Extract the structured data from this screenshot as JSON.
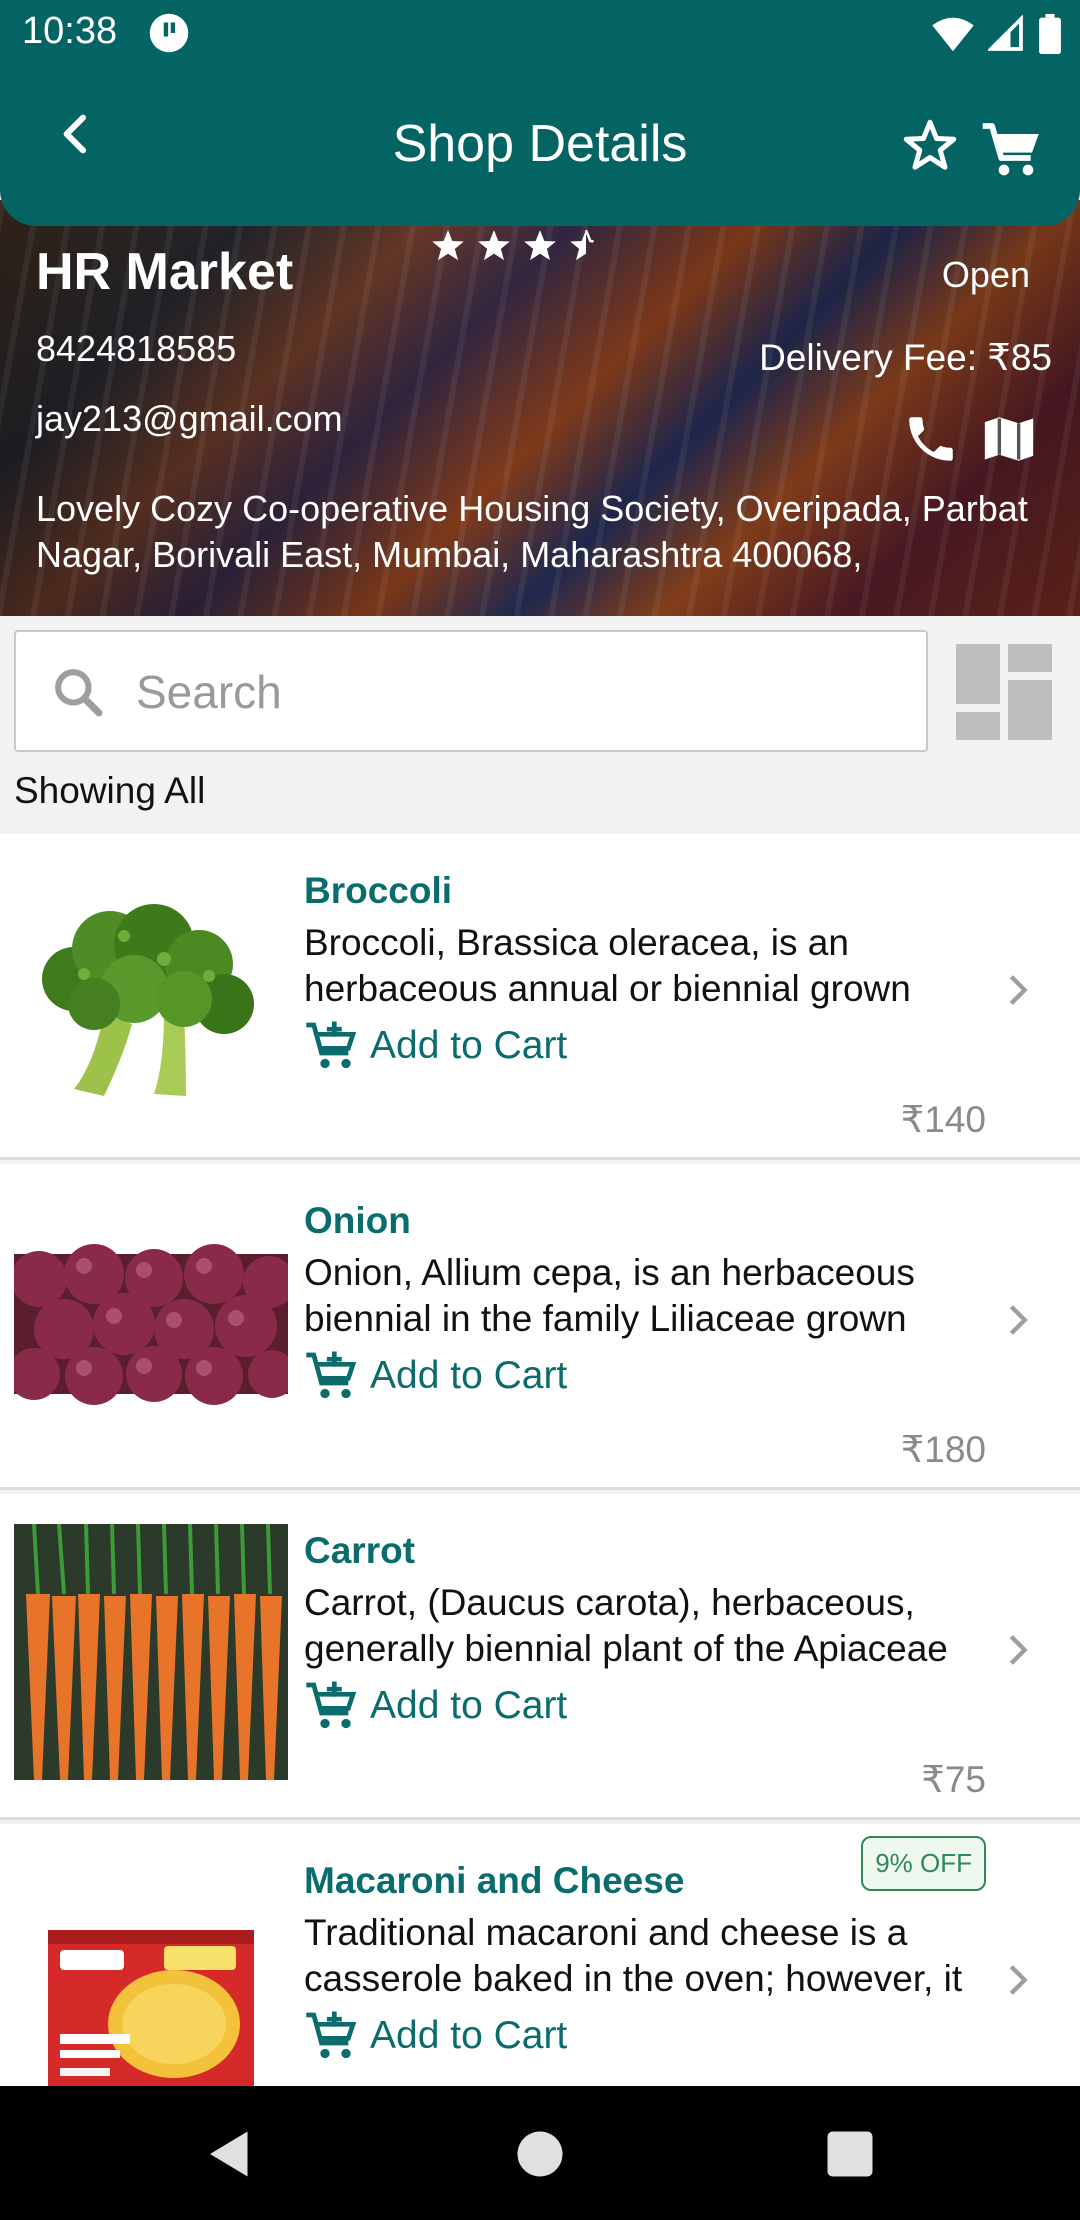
{
  "status_bar": {
    "time": "10:38"
  },
  "app_bar": {
    "title": "Shop Details"
  },
  "shop": {
    "name": "HR Market",
    "rating": 3.5,
    "status": "Open",
    "phone": "8424818585",
    "delivery_fee": "Delivery Fee: ₹85",
    "email": "jay213@gmail.com",
    "address": "Lovely Cozy Co-operative Housing Society, Overipada, Parbat Nagar, Borivali East, Mumbai, Maharashtra 400068,"
  },
  "search": {
    "placeholder": "Search",
    "value": ""
  },
  "filter": {
    "label": "Showing All"
  },
  "products": [
    {
      "name": "Broccoli",
      "desc": "Broccoli, Brassica oleracea, is an herbaceous annual or biennial grown",
      "add_label": "Add to Cart",
      "price": "₹140",
      "discount": ""
    },
    {
      "name": "Onion",
      "desc": "Onion, Allium cepa, is an herbaceous biennial in the family Liliaceae grown",
      "add_label": "Add to Cart",
      "price": "₹180",
      "discount": ""
    },
    {
      "name": "Carrot",
      "desc": "Carrot, (Daucus carota), herbaceous, generally biennial plant of the Apiaceae",
      "add_label": "Add to Cart",
      "price": "₹75",
      "discount": ""
    },
    {
      "name": "Macaroni and Cheese",
      "desc": "Traditional macaroni and cheese is a casserole baked in the oven; however, it",
      "add_label": "Add to Cart",
      "price": "",
      "discount": "9% OFF"
    }
  ],
  "colors": {
    "primary": "#046464",
    "accent_text": "#0a6c6c",
    "badge_green": "#2e8b57"
  },
  "icons": [
    "back-arrow-icon",
    "star-outline-icon",
    "cart-icon",
    "star-icon",
    "half-star-icon",
    "phone-icon",
    "map-icon",
    "search-icon",
    "grid-view-icon",
    "add-cart-icon",
    "chevron-right-icon",
    "nav-back-icon",
    "nav-home-icon",
    "nav-recents-icon"
  ]
}
